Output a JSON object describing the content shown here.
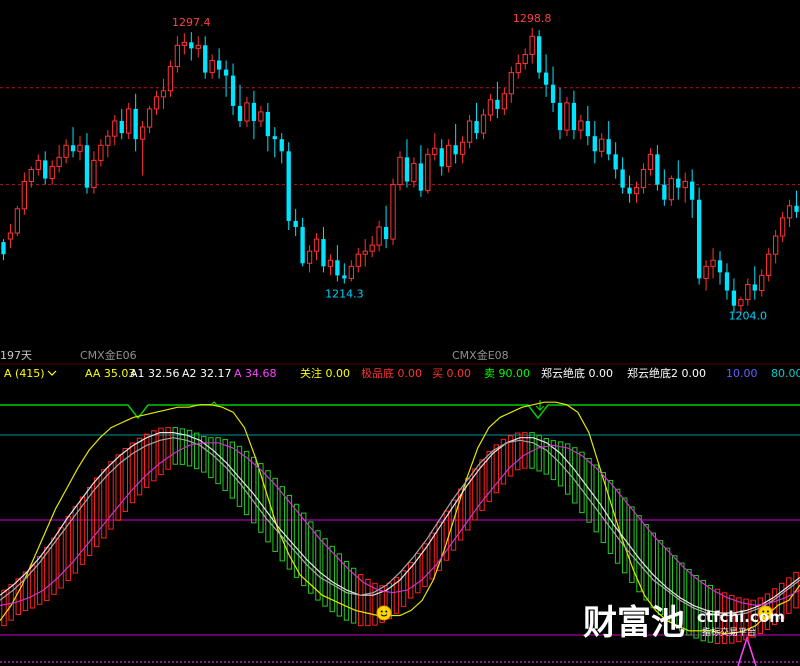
{
  "colors": {
    "bg": "#000000",
    "up": "#ff3333",
    "down": "#00e5ff",
    "dash": "#b01818",
    "label_price": "#ff4040",
    "label_low": "#00d0ff",
    "green": "#00cc00",
    "magenta": "#cc00cc",
    "yellow": "#e6e600",
    "white": "#e6e6e6",
    "grey": "#a8a8a8",
    "cyan_line": "#009999"
  },
  "price_panel": {
    "day_label": "197天",
    "contract_labels": [
      "CMX金E06",
      "CMX金E08"
    ],
    "peak_labels": [
      "1297.4",
      "1298.8"
    ],
    "low_labels": [
      "1214.3",
      "1204.0"
    ]
  },
  "indicator_bar": [
    {
      "label": "A (415)",
      "color": "#ffff00",
      "icon": "chevron-down-icon"
    },
    {
      "label": "AA 35.03",
      "color": "#ffff00"
    },
    {
      "label": "A1 32.56",
      "color": "#ffffff"
    },
    {
      "label": "A2 32.17",
      "color": "#ffffff"
    },
    {
      "label": "A 34.68",
      "color": "#ff44ff"
    },
    {
      "label": "关注 0.00",
      "color": "#ffff00"
    },
    {
      "label": "极品底 0.00",
      "color": "#ff3333"
    },
    {
      "label": "买 0.00",
      "color": "#ff3333"
    },
    {
      "label": "卖 90.00",
      "color": "#00ff00"
    },
    {
      "label": "郑云绝底 0.00",
      "color": "#ffffff"
    },
    {
      "label": "郑云绝底2 0.00",
      "color": "#ffffff"
    },
    {
      "label": "10.00",
      "color": "#6060ff"
    },
    {
      "label": "80.00",
      "color": "#00cccc"
    }
  ],
  "watermark": {
    "brand": "财富池",
    "domain": "ctfchi.com",
    "tagline": "指标交易平台"
  },
  "chart_data": [
    {
      "type": "candlestick",
      "title": "",
      "ylim": [
        1195,
        1306
      ],
      "reference_lines": [
        1279,
        1247
      ],
      "annotations": [
        {
          "text": "1297.4",
          "kind": "high",
          "index": 27
        },
        {
          "text": "1298.8",
          "kind": "high",
          "index": 76
        },
        {
          "text": "1214.3",
          "kind": "low",
          "index": 49
        },
        {
          "text": "1204.0",
          "kind": "low",
          "index": 107
        }
      ],
      "candles": [
        [
          1228,
          1229,
          1224,
          1222
        ],
        [
          1229,
          1234,
          1231,
          1226
        ],
        [
          1231,
          1240,
          1239,
          1230
        ],
        [
          1239,
          1251,
          1248,
          1237
        ],
        [
          1248,
          1253,
          1252,
          1246
        ],
        [
          1252,
          1257,
          1255,
          1250
        ],
        [
          1255,
          1258,
          1249,
          1247
        ],
        [
          1249,
          1255,
          1253,
          1247
        ],
        [
          1253,
          1260,
          1256,
          1251
        ],
        [
          1256,
          1262,
          1260,
          1254
        ],
        [
          1260,
          1266,
          1258,
          1256
        ],
        [
          1258,
          1263,
          1260,
          1255
        ],
        [
          1260,
          1264,
          1246,
          1244
        ],
        [
          1246,
          1258,
          1255,
          1244
        ],
        [
          1255,
          1262,
          1260,
          1253
        ],
        [
          1260,
          1265,
          1263,
          1256
        ],
        [
          1263,
          1270,
          1268,
          1260
        ],
        [
          1268,
          1272,
          1264,
          1262
        ],
        [
          1264,
          1274,
          1272,
          1262
        ],
        [
          1272,
          1277,
          1262,
          1258
        ],
        [
          1262,
          1268,
          1266,
          1250
        ],
        [
          1266,
          1273,
          1272,
          1264
        ],
        [
          1272,
          1278,
          1276,
          1270
        ],
        [
          1276,
          1282,
          1278,
          1272
        ],
        [
          1278,
          1288,
          1286,
          1276
        ],
        [
          1286,
          1296,
          1293,
          1284
        ],
        [
          1293,
          1297,
          1294,
          1290
        ],
        [
          1294,
          1297.4,
          1292,
          1288
        ],
        [
          1292,
          1296,
          1293,
          1289
        ],
        [
          1293,
          1296,
          1284,
          1282
        ],
        [
          1284,
          1290,
          1288,
          1282
        ],
        [
          1288,
          1292,
          1285,
          1282
        ],
        [
          1285,
          1288,
          1283,
          1276
        ],
        [
          1283,
          1287,
          1273,
          1270
        ],
        [
          1273,
          1280,
          1268,
          1266
        ],
        [
          1268,
          1276,
          1274,
          1266
        ],
        [
          1274,
          1278,
          1268,
          1262
        ],
        [
          1268,
          1273,
          1271,
          1266
        ],
        [
          1271,
          1274,
          1263,
          1258
        ],
        [
          1263,
          1266,
          1262,
          1256
        ],
        [
          1262,
          1264,
          1258,
          1254
        ],
        [
          1258,
          1261,
          1235,
          1232
        ],
        [
          1235,
          1239,
          1233,
          1230
        ],
        [
          1233,
          1236,
          1221,
          1220
        ],
        [
          1221,
          1227,
          1225,
          1218
        ],
        [
          1225,
          1231,
          1229,
          1222
        ],
        [
          1229,
          1233,
          1220,
          1218
        ],
        [
          1220,
          1224,
          1222,
          1217
        ],
        [
          1222,
          1227,
          1217,
          1215
        ],
        [
          1217,
          1221,
          1216,
          1214.3
        ],
        [
          1216,
          1222,
          1220,
          1215
        ],
        [
          1220,
          1226,
          1224,
          1218
        ],
        [
          1224,
          1229,
          1225,
          1220
        ],
        [
          1225,
          1230,
          1227,
          1223
        ],
        [
          1227,
          1235,
          1233,
          1225
        ],
        [
          1233,
          1240,
          1229,
          1226
        ],
        [
          1229,
          1249,
          1247,
          1227
        ],
        [
          1247,
          1258,
          1256,
          1245
        ],
        [
          1256,
          1262,
          1248,
          1246
        ],
        [
          1248,
          1256,
          1254,
          1246
        ],
        [
          1254,
          1260,
          1245,
          1243
        ],
        [
          1245,
          1259,
          1257,
          1244
        ],
        [
          1257,
          1264,
          1259,
          1255
        ],
        [
          1259,
          1262,
          1253,
          1250
        ],
        [
          1253,
          1262,
          1260,
          1251
        ],
        [
          1260,
          1267,
          1257,
          1254
        ],
        [
          1257,
          1263,
          1261,
          1254
        ],
        [
          1261,
          1270,
          1268,
          1259
        ],
        [
          1268,
          1274,
          1264,
          1262
        ],
        [
          1264,
          1272,
          1270,
          1262
        ],
        [
          1270,
          1277,
          1275,
          1268
        ],
        [
          1275,
          1281,
          1272,
          1269
        ],
        [
          1272,
          1279,
          1277,
          1270
        ],
        [
          1277,
          1286,
          1284,
          1274
        ],
        [
          1284,
          1290,
          1287,
          1282
        ],
        [
          1287,
          1292,
          1290,
          1285
        ],
        [
          1290,
          1298.8,
          1296,
          1287
        ],
        [
          1296,
          1298,
          1284,
          1282
        ],
        [
          1284,
          1290,
          1280,
          1276
        ],
        [
          1280,
          1286,
          1274,
          1271
        ],
        [
          1274,
          1279,
          1265,
          1262
        ],
        [
          1265,
          1276,
          1274,
          1263
        ],
        [
          1274,
          1278,
          1265,
          1262
        ],
        [
          1265,
          1270,
          1268,
          1262
        ],
        [
          1268,
          1273,
          1263,
          1260
        ],
        [
          1263,
          1268,
          1258,
          1254
        ],
        [
          1258,
          1264,
          1262,
          1256
        ],
        [
          1262,
          1268,
          1257,
          1255
        ],
        [
          1257,
          1261,
          1252,
          1249
        ],
        [
          1252,
          1256,
          1246,
          1244
        ],
        [
          1246,
          1250,
          1244,
          1241
        ],
        [
          1244,
          1248,
          1246,
          1241
        ],
        [
          1246,
          1254,
          1252,
          1244
        ],
        [
          1252,
          1259,
          1257,
          1250
        ],
        [
          1257,
          1260,
          1247,
          1245
        ],
        [
          1247,
          1252,
          1242,
          1240
        ],
        [
          1242,
          1250,
          1249,
          1240
        ],
        [
          1249,
          1255,
          1246,
          1242
        ],
        [
          1246,
          1251,
          1248,
          1241
        ],
        [
          1248,
          1252,
          1242,
          1236
        ],
        [
          1242,
          1246,
          1216,
          1214
        ],
        [
          1216,
          1222,
          1220,
          1212
        ],
        [
          1220,
          1226,
          1222,
          1216
        ],
        [
          1222,
          1225,
          1218,
          1214
        ],
        [
          1218,
          1221,
          1212,
          1209
        ],
        [
          1212,
          1216,
          1207,
          1204.5
        ],
        [
          1207,
          1210,
          1209,
          1204
        ],
        [
          1209,
          1216,
          1214,
          1207
        ],
        [
          1214,
          1220,
          1212,
          1209
        ],
        [
          1212,
          1219,
          1217,
          1210
        ],
        [
          1217,
          1226,
          1224,
          1215
        ],
        [
          1224,
          1232,
          1230,
          1221
        ],
        [
          1230,
          1238,
          1236,
          1228
        ],
        [
          1236,
          1242,
          1240,
          1233
        ],
        [
          1240,
          1245,
          1238,
          1236
        ]
      ]
    },
    {
      "type": "line",
      "title": "",
      "ylim": [
        0,
        100
      ],
      "reference_lines": [
        80,
        50,
        10
      ],
      "series": [
        {
          "name": "AA",
          "values": [
            10,
            16,
            24,
            34,
            44,
            54,
            62,
            70,
            77,
            82,
            86,
            88,
            90,
            91,
            92,
            93,
            94,
            94,
            95,
            95,
            94,
            92,
            86,
            74,
            60,
            46,
            36,
            28,
            24,
            20,
            18,
            16,
            14,
            13,
            12,
            12,
            12,
            14,
            18,
            26,
            38,
            52,
            66,
            78,
            86,
            90,
            92,
            94,
            95,
            96,
            96,
            95,
            92,
            84,
            70,
            56,
            42,
            30,
            20,
            14,
            10,
            8,
            6,
            6,
            6,
            5,
            5,
            6,
            8,
            12,
            16,
            18,
            24
          ]
        },
        {
          "name": "A1",
          "values": [
            20,
            24,
            29,
            35,
            42,
            50,
            57,
            64,
            70,
            75,
            79,
            82,
            84,
            84,
            83,
            81,
            77,
            72,
            66,
            60,
            53,
            46,
            40,
            34,
            29,
            25,
            22,
            20,
            20,
            22,
            26,
            32,
            39,
            47,
            55,
            63,
            70,
            76,
            80,
            82,
            82,
            80,
            76,
            70,
            63,
            56,
            48,
            41,
            34,
            28,
            23,
            19,
            16,
            14,
            13,
            13,
            14,
            16,
            19,
            23,
            27
          ]
        },
        {
          "name": "A2",
          "values": [
            18,
            22,
            27,
            33,
            40,
            47,
            54,
            61,
            67,
            72,
            76,
            79,
            81,
            82,
            81,
            79,
            75,
            70,
            64,
            57,
            50,
            44,
            38,
            32,
            27,
            24,
            21,
            20,
            21,
            24,
            29,
            35,
            42,
            50,
            58,
            65,
            72,
            77,
            80,
            81,
            80,
            77,
            72,
            66,
            59,
            52,
            45,
            38,
            32,
            26,
            22,
            18,
            15,
            13,
            12,
            12,
            13,
            15,
            18,
            22,
            26
          ]
        },
        {
          "name": "A",
          "values": [
            16,
            17,
            19,
            22,
            27,
            33,
            40,
            47,
            54,
            61,
            67,
            72,
            76,
            79,
            80,
            80,
            78,
            74,
            69,
            63,
            56,
            49,
            42,
            36,
            30,
            25,
            22,
            21,
            22,
            26,
            32,
            40,
            48,
            56,
            63,
            70,
            75,
            78,
            79,
            78,
            75,
            70,
            64,
            57,
            50,
            43,
            37,
            31,
            26,
            22,
            19,
            17,
            16,
            17,
            19,
            22
          ]
        }
      ],
      "bars": {
        "green_to_red_levels": [
          [
            49,
            49
          ],
          [
            52,
            52
          ],
          [
            49,
            49
          ],
          [
            54,
            54
          ],
          [
            57,
            57
          ],
          [
            60,
            60
          ],
          [
            63,
            63
          ],
          [
            66,
            66
          ],
          [
            69,
            69
          ],
          [
            71,
            71
          ],
          [
            73,
            73
          ],
          [
            75,
            75
          ],
          [
            77,
            77
          ],
          [
            79,
            79
          ],
          [
            81,
            81
          ],
          [
            83,
            83
          ],
          [
            85,
            85
          ],
          [
            86,
            86
          ],
          [
            86,
            86
          ],
          [
            86,
            86
          ],
          [
            85,
            85
          ],
          [
            84,
            84
          ],
          [
            83,
            83
          ],
          [
            81,
            81
          ],
          [
            78,
            78
          ]
        ]
      },
      "markers": [
        {
          "kind": "smiley",
          "x_fraction": 0.48,
          "y": 13
        },
        {
          "kind": "smiley",
          "x_fraction": 0.957,
          "y": 13
        }
      ]
    }
  ]
}
